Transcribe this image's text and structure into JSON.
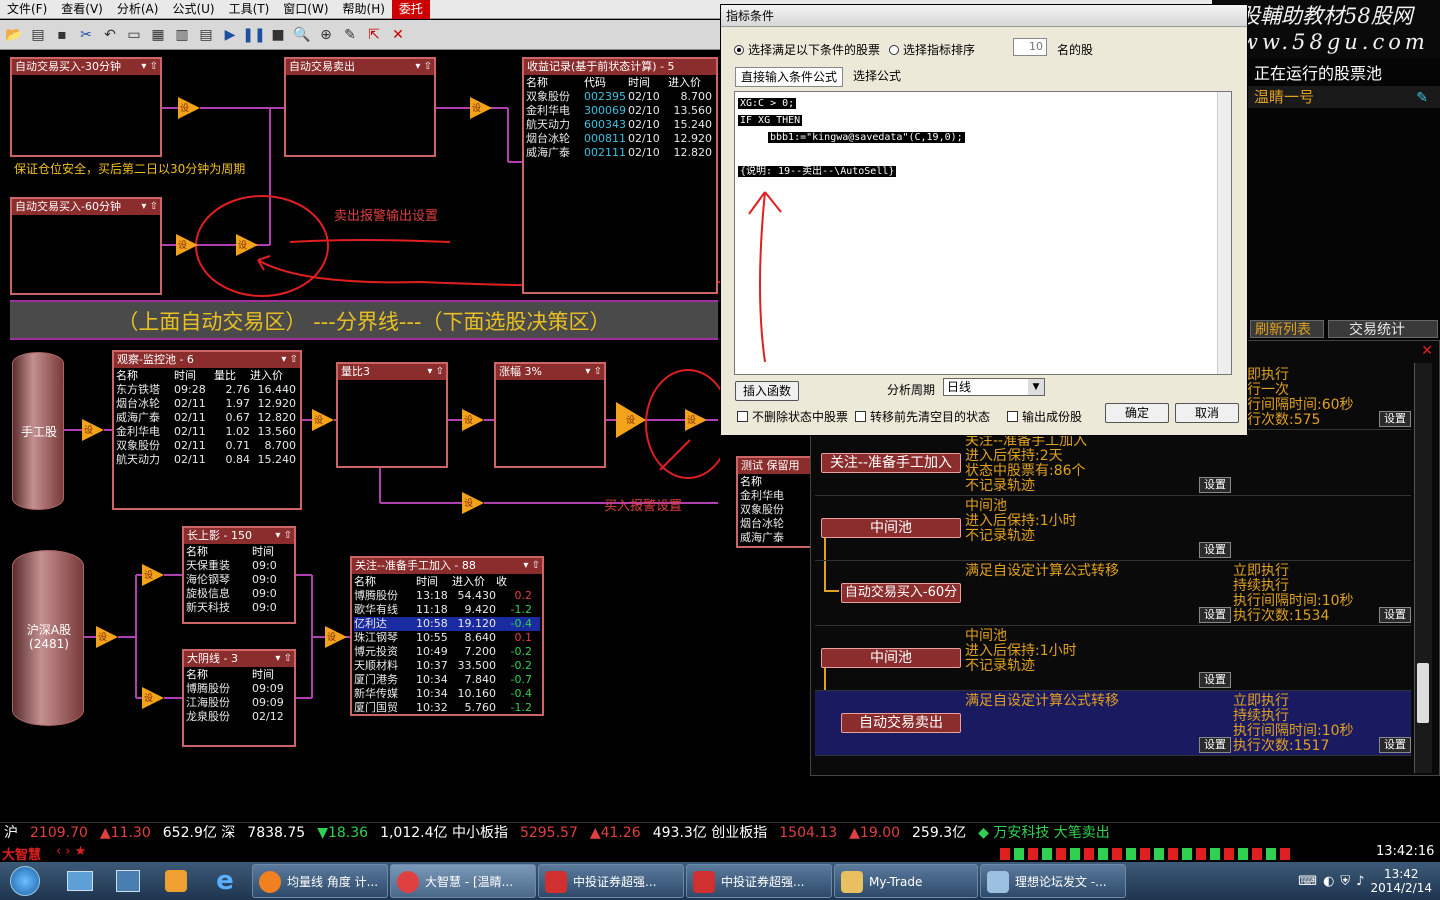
{
  "menu": [
    "文件(F)",
    "查看(V)",
    "分析(A)",
    "公式(U)",
    "工具(T)",
    "窗口(W)",
    "帮助(H)",
    "委托"
  ],
  "watermark": {
    "line1": "炒股輔助教材58股网",
    "line2": "www.58gu.com"
  },
  "top_boxes": {
    "buy30": {
      "title": "自动交易买入-30分钟"
    },
    "sell": {
      "title": "自动交易卖出"
    },
    "buy60": {
      "title": "自动交易买入-60分钟"
    },
    "profit": {
      "title": "收益记录(基于前状态计算) - 5",
      "cols": [
        "名称",
        "代码",
        "时间",
        "进入价"
      ],
      "rows": [
        [
          "双象股份",
          "002395",
          "02/10",
          "8.700"
        ],
        [
          "金利华电",
          "300069",
          "02/10",
          "13.560"
        ],
        [
          "航天动力",
          "600343",
          "02/10",
          "15.240"
        ],
        [
          "烟台冰轮",
          "000811",
          "02/10",
          "12.920"
        ],
        [
          "威海广泰",
          "002111",
          "02/10",
          "12.820"
        ]
      ]
    }
  },
  "annotations": {
    "margin_note": "保证仓位安全，买后第二日以30分钟为周期",
    "sell_alarm": "卖出报警输出设置",
    "buy_alarm": "买入报警设置"
  },
  "divider": "（上面自动交易区） ---分界线---（下面选股决策区）",
  "node_label": "设",
  "lower": {
    "cyl1": "手工股",
    "cyl2": "沪深A股\n(2481)",
    "watch": {
      "title": "观察-监控池 - 6",
      "cols": [
        "名称",
        "时间",
        "量比",
        "进入价"
      ],
      "rows": [
        [
          "东方铁塔",
          "09:28",
          "2.76",
          "16.440"
        ],
        [
          "烟台冰轮",
          "02/11",
          "1.97",
          "12.920"
        ],
        [
          "威海广泰",
          "02/11",
          "0.67",
          "12.820"
        ],
        [
          "金利华电",
          "02/11",
          "1.02",
          "13.560"
        ],
        [
          "双象股份",
          "02/11",
          "0.71",
          "8.700"
        ],
        [
          "航天动力",
          "02/11",
          "0.84",
          "15.240"
        ]
      ]
    },
    "liangbi": {
      "title": "量比3"
    },
    "zhangfu": {
      "title": "涨幅 3%"
    },
    "test": {
      "title": "测试 保留用",
      "col": "名称",
      "rows": [
        "金利华电",
        "双象股份",
        "烟台冰轮",
        "威海广泰"
      ]
    },
    "shadow": {
      "title": "长上影 - 150",
      "cols": [
        "名称",
        "时间"
      ],
      "rows": [
        [
          "天保重装",
          "09:0"
        ],
        [
          "海伦钢琴",
          "09:0"
        ],
        [
          "旋极信息",
          "09:0"
        ],
        [
          "新天科技",
          "09:0"
        ]
      ]
    },
    "yinline": {
      "title": "大阴线 - 3",
      "cols": [
        "名称",
        "时间"
      ],
      "rows": [
        [
          "博腾股份",
          "09:09"
        ],
        [
          "江海股份",
          "09:09"
        ],
        [
          "龙泉股份",
          "02/12"
        ]
      ]
    },
    "focus": {
      "title": "关注--准备手工加入 - 88",
      "cols": [
        "名称",
        "时间",
        "进入价",
        "收"
      ],
      "rows": [
        [
          "博腾股份",
          "13:18",
          "54.430",
          "0.2"
        ],
        [
          "歌华有线",
          "11:18",
          "9.420",
          "-1.2"
        ],
        [
          "亿利达",
          "10:58",
          "19.120",
          "-0.4"
        ],
        [
          "珠江钢琴",
          "10:55",
          "8.640",
          "0.1"
        ],
        [
          "博元投资",
          "10:49",
          "7.200",
          "-0.2"
        ],
        [
          "天顺材料",
          "10:37",
          "33.500",
          "-0.2"
        ],
        [
          "厦门港务",
          "10:34",
          "7.840",
          "-0.7"
        ],
        [
          "新华传媒",
          "10:34",
          "10.160",
          "-0.4"
        ],
        [
          "厦门国贸",
          "10:32",
          "5.760",
          "-1.2"
        ]
      ]
    }
  },
  "dialog": {
    "title": "指标条件",
    "radio1": "选择满足以下条件的股票",
    "radio2": "选择指标排序",
    "count": "10",
    "count_suffix": "名的股",
    "tab1": "直接输入条件公式",
    "tab2": "选择公式",
    "code": [
      "XG:C > 0;",
      "IF XG THEN",
      "    bbb1:=\"kingwa@savedata\"(C,19,0);",
      "",
      "{说明: 19--卖出--\\AutoSell}"
    ],
    "insert_btn": "插入函数",
    "period_label": "分析周期",
    "period_value": "日线",
    "chk1": "不删除状态中股票",
    "chk2": "转移前先清空目的状态",
    "chk3": "输出成份股",
    "ok": "确定",
    "cancel": "取消"
  },
  "right_top": {
    "title": "正在运行的股票池",
    "sub": "温睛一号",
    "tab1": "刷新列表",
    "tab2": "交易统计"
  },
  "right_panel": {
    "set": "设置",
    "r1_right": [
      "立即执行",
      "执行一次",
      "执行间隔时间:60秒",
      "执行次数:575"
    ],
    "r2_btn": "关注--准备手工加入",
    "r2_mid": [
      "关注--准备手工加入",
      "进入后保持:2天",
      "状态中股票有:86个",
      "不记录轨迹"
    ],
    "r3_btn": "中间池",
    "r3_mid": [
      "中间池",
      "进入后保持:1小时",
      "不记录轨迹"
    ],
    "r4_btn": "自动交易买入-60分",
    "r4_mid": "满足自设定计算公式转移",
    "r4_right": [
      "立即执行",
      "持续执行",
      "执行间隔时间:10秒",
      "执行次数:1534"
    ],
    "r5_btn": "中间池",
    "r5_mid": [
      "中间池",
      "进入后保持:1小时",
      "不记录轨迹"
    ],
    "r6_btn": "自动交易卖出",
    "r6_mid": "满足自设定计算公式转移",
    "r6_right": [
      "立即执行",
      "持续执行",
      "执行间隔时间:10秒",
      "执行次数:1517"
    ]
  },
  "status": {
    "items": [
      {
        "t": "沪",
        "c": "#fff"
      },
      {
        "t": "2109.70",
        "c": "#e04040"
      },
      {
        "t": "▲11.30",
        "c": "#e04040"
      },
      {
        "t": "652.9亿 深",
        "c": "#fff"
      },
      {
        "t": "7838.75",
        "c": "#fff"
      },
      {
        "t": "▼18.36",
        "c": "#30d050"
      },
      {
        "t": "1,012.4亿 中小板指",
        "c": "#fff"
      },
      {
        "t": "5295.57",
        "c": "#e04040"
      },
      {
        "t": "▲41.26",
        "c": "#e04040"
      },
      {
        "t": "493.3亿 创业板指",
        "c": "#fff"
      },
      {
        "t": "1504.13",
        "c": "#e04040"
      },
      {
        "t": "▲19.00",
        "c": "#e04040"
      },
      {
        "t": "259.3亿",
        "c": "#fff"
      },
      {
        "t": "◆ 万安科技 大笔卖出",
        "c": "#30d050"
      }
    ],
    "brand": "大智慧",
    "time": "13:42:16"
  },
  "taskbar": {
    "tasks": [
      "均量线 角度 计...",
      "大智慧 - [温睛...",
      "中投证券超强...",
      "中投证券超强...",
      "My-Trade",
      "理想论坛发文 -..."
    ],
    "clock_time": "13:42",
    "clock_date": "2014/2/14"
  },
  "colors": {
    "accent": "#f3a21b",
    "box_title": "#8b2d2d",
    "highlight_red": "#e02020"
  }
}
